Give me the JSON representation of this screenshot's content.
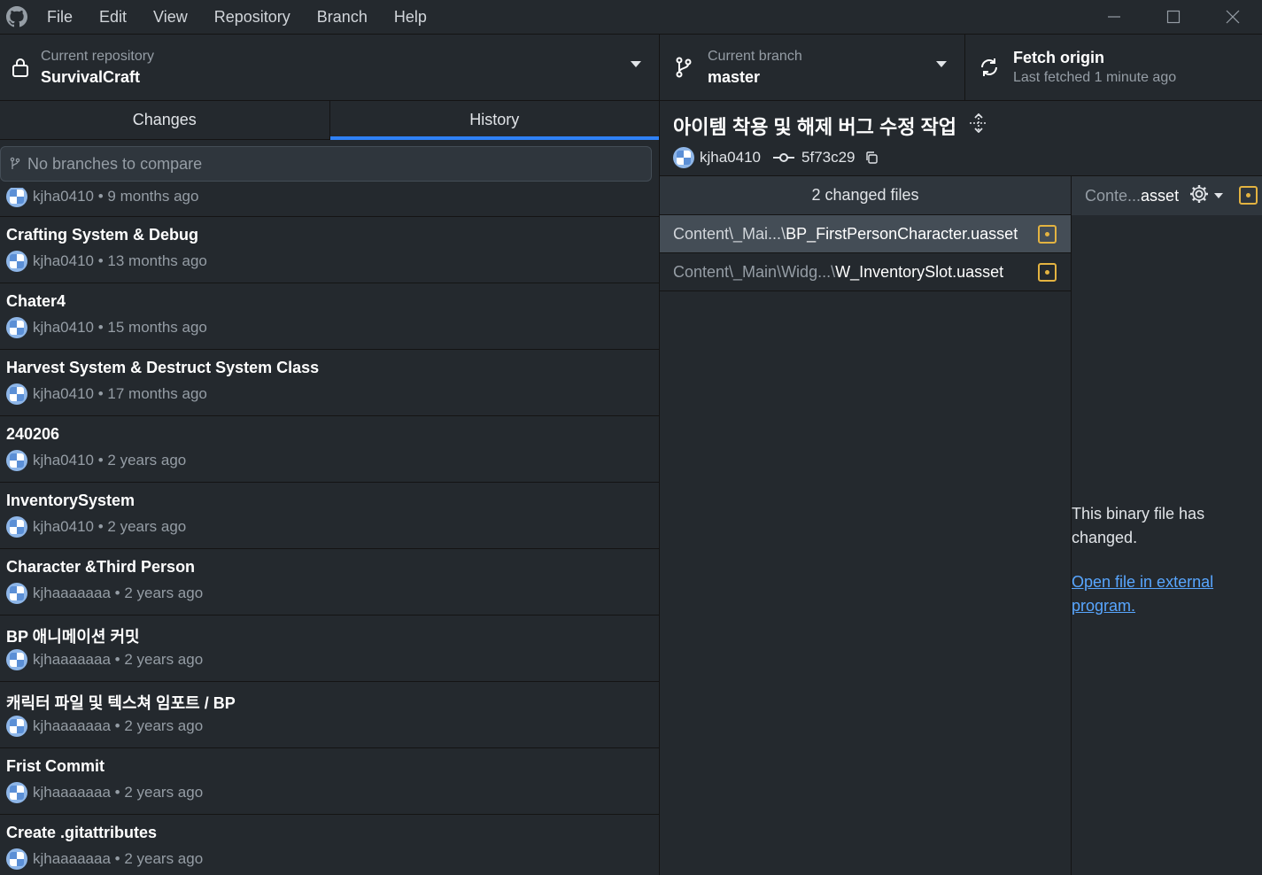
{
  "menu": [
    "File",
    "Edit",
    "View",
    "Repository",
    "Branch",
    "Help"
  ],
  "toolbar": {
    "repo_label": "Current repository",
    "repo_name": "SurvivalCraft",
    "branch_label": "Current branch",
    "branch_name": "master",
    "fetch_title": "Fetch origin",
    "fetch_sub": "Last fetched 1 minute ago"
  },
  "tabs": {
    "changes": "Changes",
    "history": "History"
  },
  "compare_placeholder": "No branches to compare",
  "commits": [
    {
      "summary": "",
      "author": "kjha0410",
      "time": "9 months ago"
    },
    {
      "summary": "Crafting System & Debug",
      "author": "kjha0410",
      "time": "13 months ago"
    },
    {
      "summary": "Chater4",
      "author": "kjha0410",
      "time": "15 months ago"
    },
    {
      "summary": "Harvest System & Destruct System Class",
      "author": "kjha0410",
      "time": "17 months ago"
    },
    {
      "summary": "240206",
      "author": "kjha0410",
      "time": "2 years ago"
    },
    {
      "summary": "InventorySystem",
      "author": "kjha0410",
      "time": "2 years ago"
    },
    {
      "summary": "Character &Third Person",
      "author": "kjhaaaaaaa",
      "time": "2 years ago"
    },
    {
      "summary": "BP 애니메이션 커밋",
      "author": "kjhaaaaaaa",
      "time": "2 years ago"
    },
    {
      "summary": "캐릭터 파일 및 텍스쳐 임포트 / BP",
      "author": "kjhaaaaaaa",
      "time": "2 years ago"
    },
    {
      "summary": "Frist Commit",
      "author": "kjhaaaaaaa",
      "time": "2 years ago"
    },
    {
      "summary": "Create .gitattributes",
      "author": "kjhaaaaaaa",
      "time": "2 years ago"
    }
  ],
  "selected_commit": {
    "title": "아이템 착용 및 해제 버그 수정 작업",
    "author": "kjha0410",
    "sha": "5f73c29"
  },
  "files": {
    "header": "2 changed files",
    "items": [
      {
        "dir": "Content\\_Mai...\\",
        "name": "BP_FirstPersonCharacter.uasset"
      },
      {
        "dir": "Content\\_Main\\Widg...\\",
        "name": "W_InventorySlot.uasset"
      }
    ]
  },
  "diff": {
    "file_prefix": "Conte...",
    "file_suffix": "asset",
    "binary_msg": "This binary file has changed.",
    "open_link": "Open file in external program."
  },
  "colors": {
    "accent": "#2f81f7",
    "modified": "#e3b341",
    "link": "#58a6ff",
    "bg": "#24292e"
  }
}
